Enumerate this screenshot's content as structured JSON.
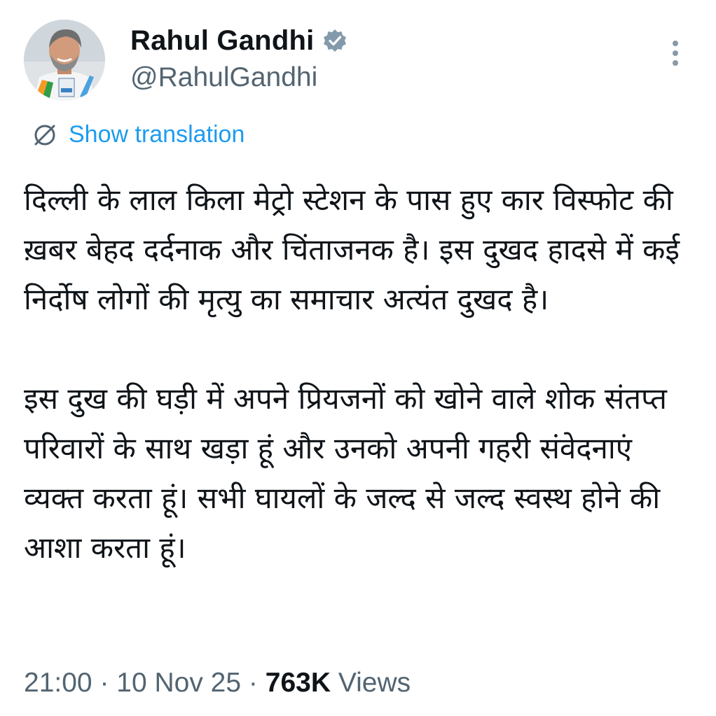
{
  "author": {
    "display_name": "Rahul Gandhi",
    "handle": "@RahulGandhi",
    "verified_badge": "verified-badge-icon"
  },
  "translation": {
    "label": "Show translation",
    "icon": "globe-slash-icon"
  },
  "tweet": {
    "paragraphs": [
      "दिल्ली के लाल किला मेट्रो स्टेशन के पास हुए कार विस्फोट की ख़बर बेहद दर्दनाक और चिंताजनक है। इस दुखद हादसे में कई निर्दोष लोगों की मृत्यु का समाचार अत्यंत दुखद है।",
      "इस दुख की घड़ी में अपने प्रियजनों को खोने वाले शोक संतप्त परिवारों के साथ खड़ा हूं और उनको अपनी गहरी संवेदनाएं व्यक्त करता हूं। सभी घायलों के जल्द से जल्द स्वस्थ होने की आशा करता हूं।"
    ]
  },
  "meta": {
    "time": "21:00",
    "separator": " · ",
    "date": "10 Nov 25",
    "views_count": "763K",
    "views_label": " Views"
  },
  "colors": {
    "text": "#0f1419",
    "secondary": "#536471",
    "link": "#1d9bf0",
    "verified": "#829aab"
  }
}
